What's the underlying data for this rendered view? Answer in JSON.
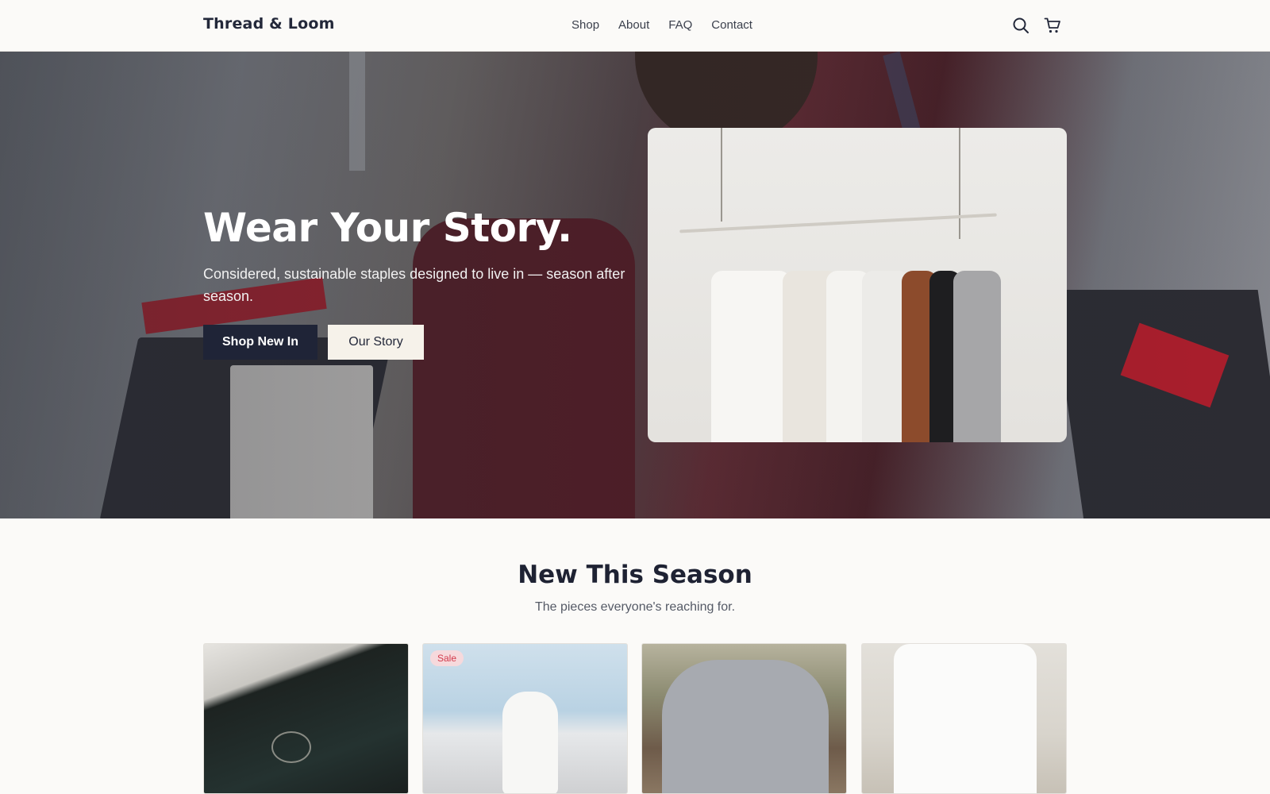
{
  "header": {
    "brand": "Thread & Loom",
    "nav": [
      "Shop",
      "About",
      "FAQ",
      "Contact"
    ],
    "icons": [
      "search-icon",
      "cart-icon"
    ]
  },
  "hero": {
    "title": "Wear Your Story.",
    "subtitle": "Considered, sustainable staples designed to live in — season after season.",
    "primary_button": "Shop New In",
    "secondary_button": "Our Story"
  },
  "section": {
    "title": "New This Season",
    "subtitle": "The pieces everyone's reaching for."
  },
  "products": [
    {
      "badge": ""
    },
    {
      "badge": "Sale"
    },
    {
      "badge": ""
    },
    {
      "badge": ""
    }
  ],
  "colors": {
    "primary_button_bg": "#1f2437",
    "secondary_button_bg": "#f6f2ea",
    "sale_badge_bg": "#f6d9dc",
    "sale_badge_text": "#d23a4b",
    "page_bg": "#fbfaf8"
  }
}
